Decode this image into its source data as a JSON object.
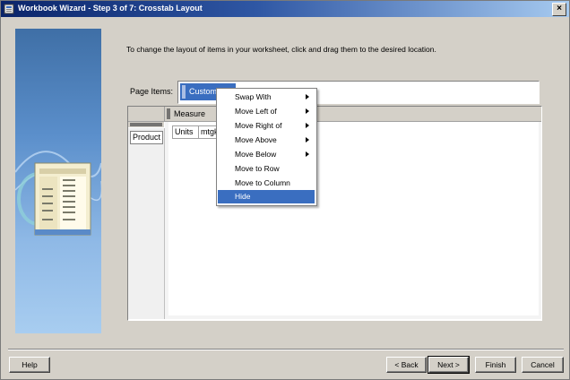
{
  "window": {
    "title": "Workbook Wizard - Step 3 of 7: Crosstab Layout"
  },
  "instructions": "To change the layout of items in your worksheet, click and drag them to the desired location.",
  "page_items": {
    "label": "Page Items:",
    "item": "Customer"
  },
  "crosstab": {
    "column_header": "Measure",
    "row_header": "Product",
    "cells": [
      "Units",
      "mtgk"
    ]
  },
  "context_menu": {
    "items": [
      {
        "label": "Swap With",
        "submenu": true
      },
      {
        "label": "Move Left of",
        "submenu": true
      },
      {
        "label": "Move Right of",
        "submenu": true
      },
      {
        "label": "Move Above",
        "submenu": true
      },
      {
        "label": "Move Below",
        "submenu": true
      },
      {
        "label": "Move to Row",
        "submenu": false
      },
      {
        "label": "Move to Column",
        "submenu": false
      },
      {
        "label": "Hide",
        "submenu": false,
        "selected": true
      }
    ]
  },
  "buttons": {
    "help": "Help",
    "back": "< Back",
    "next": "Next >",
    "finish": "Finish",
    "cancel": "Cancel"
  },
  "colors": {
    "title_start": "#0a246a",
    "title_end": "#a6caf0",
    "selection": "#3a6ec0",
    "dialog_bg": "#d4d0c8"
  },
  "icons": [
    "wizard-app-icon",
    "close-icon",
    "workbook-graphic-icon",
    "submenu-arrow-icon"
  ]
}
